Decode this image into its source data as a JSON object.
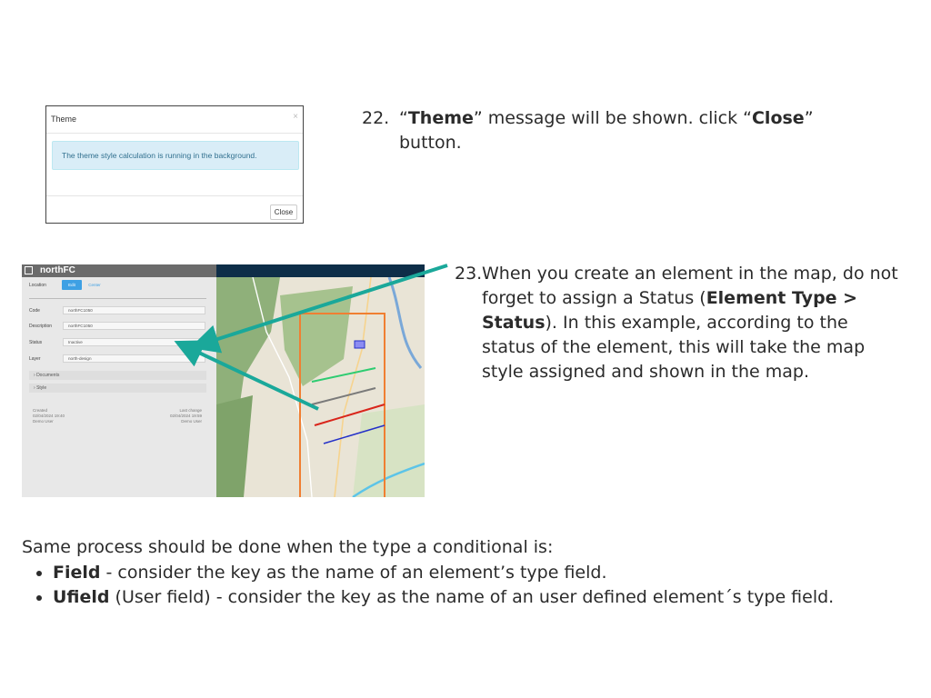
{
  "theme_dialog": {
    "title": "Theme",
    "close_x": "×",
    "message": "The theme style calculation is running in the background.",
    "close_button": "Close"
  },
  "step22": {
    "number": "22.",
    "q_open": "“",
    "bold1": "Theme",
    "text1": "” message will be shown. click “",
    "bold2": "Close",
    "text2": "” button."
  },
  "step23": {
    "number": "23.",
    "text1": "When you create an element in the map, do not forget to assign a Status (",
    "bold1": "Element Type > Status",
    "text2": "). In this example, according to the status of the element, this will take the map style assigned and shown in the map."
  },
  "map_panel": {
    "title": "northFC",
    "location_label": "Location",
    "edit_button": "Edit",
    "center_button": "Center",
    "code_label": "Code",
    "code_value": "northFC1050",
    "description_label": "Description",
    "description_value": "northFC1050",
    "status_label": "Status",
    "status_value": "Inactive",
    "layer_label": "Layer",
    "layer_value": "north-design",
    "documents_label": "Documents",
    "style_label": "Style",
    "created_label": "Created",
    "created_date": "02/04/2024 19:40",
    "created_user": "Demo User",
    "last_change_label": "Last change",
    "last_change_date": "02/04/2024 19:59",
    "last_change_user": "Demo User"
  },
  "map_lines": {
    "colors": [
      "#2ecc71",
      "#7a7a7a",
      "#d9251b",
      "#2430c8"
    ],
    "arrow_color": "#1aa89a",
    "boundary_color": "#f07f32"
  },
  "footer": {
    "intro": "Same process should be done when the type a conditional is:",
    "bullets": [
      {
        "bold": "Field",
        "text": " - consider the key as the name of an element’s type field."
      },
      {
        "bold": "Ufield",
        "text": " (User field) - consider the key as the name of an user defined element´s type field."
      }
    ]
  }
}
